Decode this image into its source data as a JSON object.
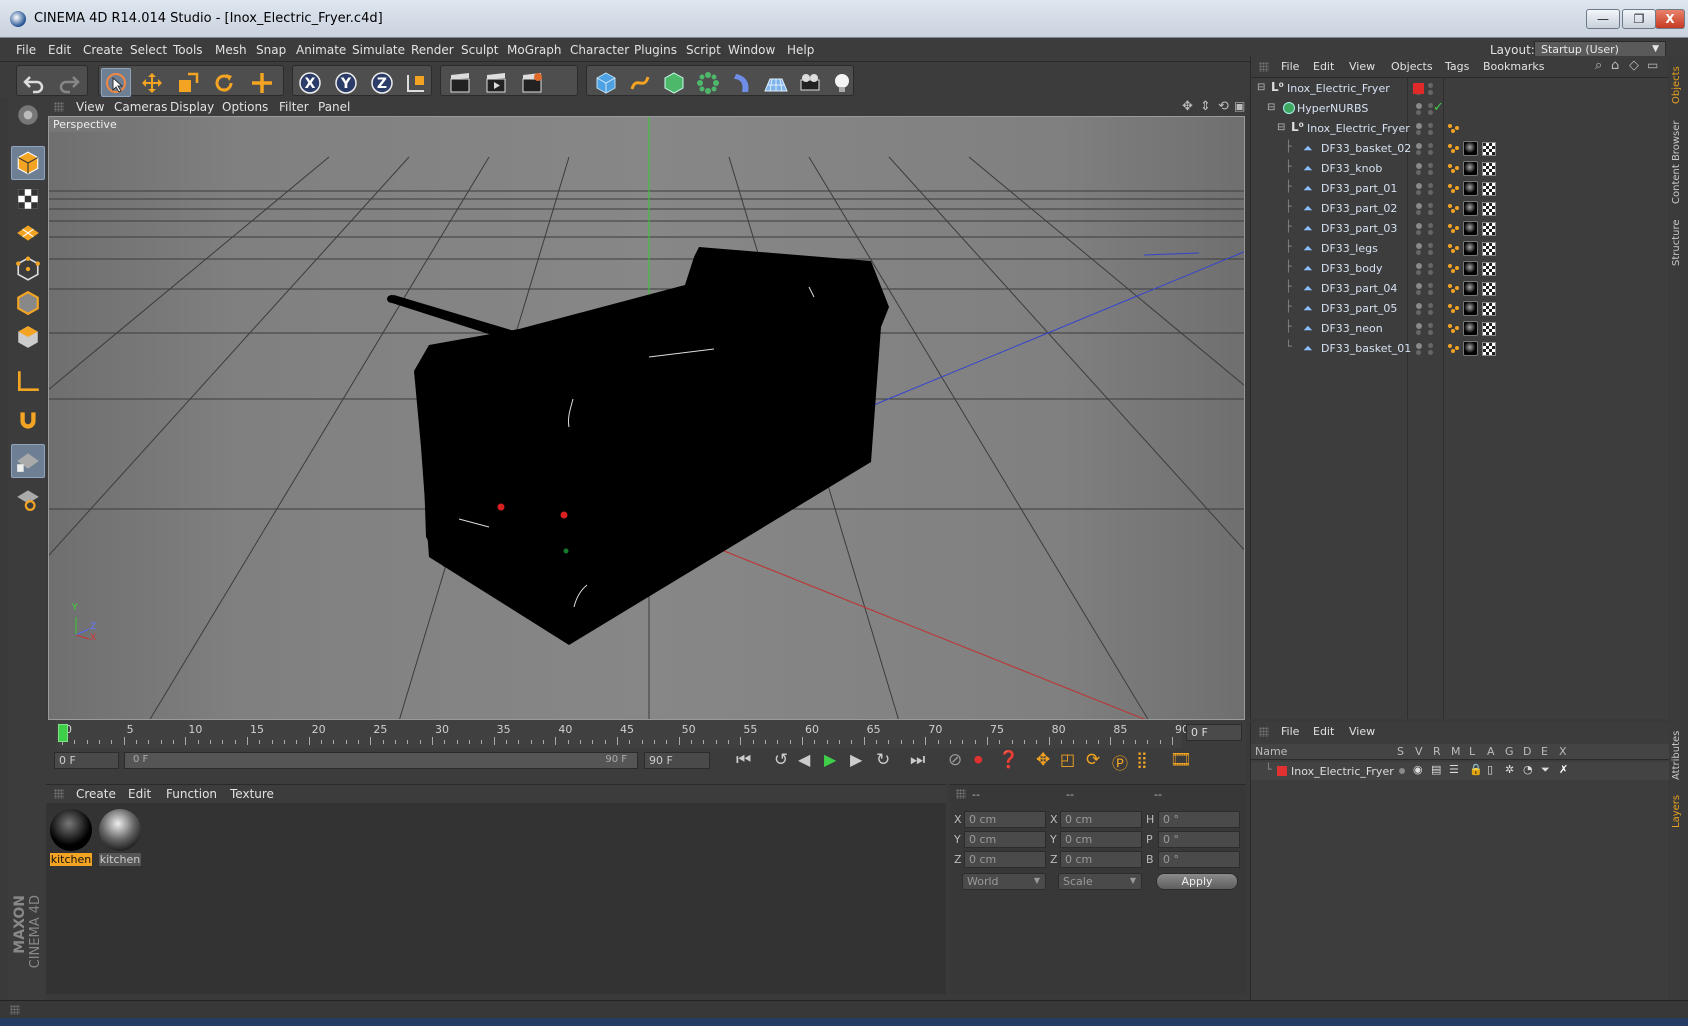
{
  "titlebar": {
    "title": "CINEMA 4D R14.014 Studio - [Inox_Electric_Fryer.c4d]",
    "min": "—",
    "restore": "❐",
    "close": "X"
  },
  "menu": {
    "items": [
      "File",
      "Edit",
      "Create",
      "Select",
      "Tools",
      "Mesh",
      "Snap",
      "Animate",
      "Simulate",
      "Render",
      "Sculpt",
      "MoGraph",
      "Character",
      "Plugins",
      "Script",
      "Window",
      "Help"
    ],
    "layout_label": "Layout:",
    "layout_value": "Startup (User)"
  },
  "viewport": {
    "menu": [
      "View",
      "Cameras",
      "Display",
      "Options",
      "Filter",
      "Panel"
    ],
    "label": "Perspective",
    "axis_y": "Y",
    "axis_z": "Z",
    "axis_x": "X"
  },
  "timeline": {
    "ticks": [
      "0",
      "5",
      "10",
      "15",
      "20",
      "25",
      "30",
      "35",
      "40",
      "45",
      "50",
      "55",
      "60",
      "65",
      "70",
      "75",
      "80",
      "85",
      "90"
    ],
    "current_frame": "0 F",
    "start_field": "0 F",
    "range_start": "0 F",
    "range_end": "90 F",
    "end_field": "90 F"
  },
  "material_manager": {
    "menu": [
      "Create",
      "Edit",
      "Function",
      "Texture"
    ],
    "materials": [
      {
        "name": "kitchen",
        "selected": true
      },
      {
        "name": "kitchen",
        "selected": false
      }
    ]
  },
  "coord_manager": {
    "headers": [
      "--",
      "--",
      "--"
    ],
    "rows": [
      {
        "a": "X",
        "av": "0 cm",
        "b": "X",
        "bv": "0 cm",
        "c": "H",
        "cv": "0 °"
      },
      {
        "a": "Y",
        "av": "0 cm",
        "b": "Y",
        "bv": "0 cm",
        "c": "P",
        "cv": "0 °"
      },
      {
        "a": "Z",
        "av": "0 cm",
        "b": "Z",
        "bv": "0 cm",
        "c": "B",
        "cv": "0 °"
      }
    ],
    "space": "World",
    "mode": "Scale",
    "apply": "Apply"
  },
  "object_manager": {
    "menu": [
      "File",
      "Edit",
      "View",
      "Objects",
      "Tags",
      "Bookmarks"
    ],
    "objects": [
      {
        "name": "Inox_Electric_Fryer",
        "level": 0
      },
      {
        "name": "HyperNURBS",
        "level": 1
      },
      {
        "name": "Inox_Electric_Fryer",
        "level": 2
      },
      {
        "name": "DF33_basket_02",
        "level": 3
      },
      {
        "name": "DF33_knob",
        "level": 3
      },
      {
        "name": "DF33_part_01",
        "level": 3
      },
      {
        "name": "DF33_part_02",
        "level": 3
      },
      {
        "name": "DF33_part_03",
        "level": 3
      },
      {
        "name": "DF33_legs",
        "level": 3
      },
      {
        "name": "DF33_body",
        "level": 3
      },
      {
        "name": "DF33_part_04",
        "level": 3
      },
      {
        "name": "DF33_part_05",
        "level": 3
      },
      {
        "name": "DF33_neon",
        "level": 3
      },
      {
        "name": "DF33_basket_01",
        "level": 3
      }
    ]
  },
  "layer_manager": {
    "menu": [
      "File",
      "Edit",
      "View"
    ],
    "columns": [
      "Name",
      "S",
      "V",
      "R",
      "M",
      "L",
      "A",
      "G",
      "D",
      "E",
      "X"
    ],
    "layers": [
      {
        "name": "Inox_Electric_Fryer",
        "color": "#e03030"
      }
    ]
  },
  "side_tabs": [
    "Objects",
    "Content Browser",
    "Structure",
    "Attributes",
    "Layers"
  ],
  "branding": {
    "maxon": "MAXON",
    "cinema": "CINEMA 4D"
  },
  "colors": {
    "accent": "#e8a020",
    "select": "#6f7f93"
  }
}
